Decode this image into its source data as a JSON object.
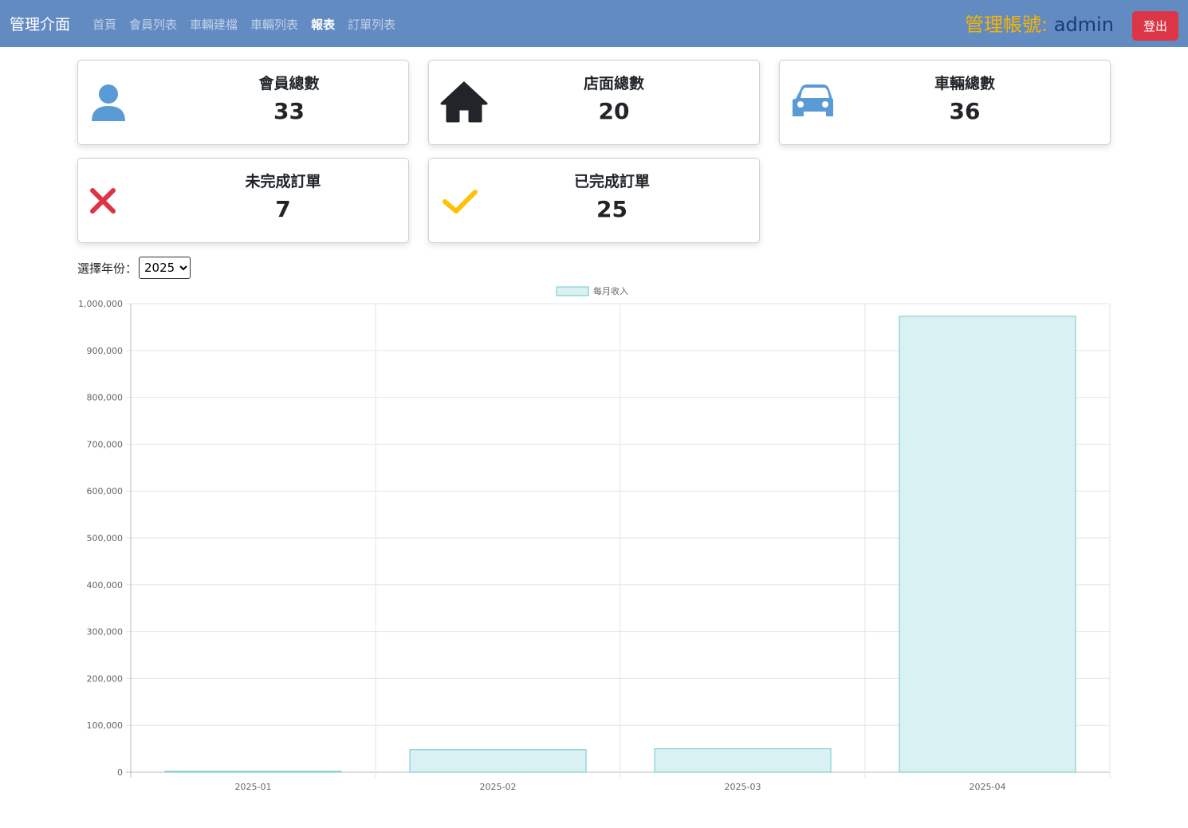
{
  "navbar": {
    "brand": "管理介面",
    "links": [
      {
        "label": "首頁",
        "active": false
      },
      {
        "label": "會員列表",
        "active": false
      },
      {
        "label": "車輛建檔",
        "active": false
      },
      {
        "label": "車輛列表",
        "active": false
      },
      {
        "label": "報表",
        "active": true
      },
      {
        "label": "訂單列表",
        "active": false
      }
    ],
    "admin_prefix": "管理帳號:",
    "admin_name": "admin",
    "logout_label": "登出"
  },
  "cards": [
    {
      "label": "會員總數",
      "value": "33",
      "icon": "user-icon",
      "icon_color": "#5b9bd5"
    },
    {
      "label": "店面總數",
      "value": "20",
      "icon": "house-icon",
      "icon_color": "#212529"
    },
    {
      "label": "車輛總數",
      "value": "36",
      "icon": "car-icon",
      "icon_color": "#5b9bd5"
    },
    {
      "label": "未完成訂單",
      "value": "7",
      "icon": "x-icon",
      "icon_color": "#dc3545"
    },
    {
      "label": "已完成訂單",
      "value": "25",
      "icon": "check-icon",
      "icon_color": "#ffc107"
    }
  ],
  "year_filter": {
    "label": "選擇年份：",
    "selected": "2025"
  },
  "chart_data": {
    "type": "bar",
    "categories": [
      "2025-01",
      "2025-02",
      "2025-03",
      "2025-04"
    ],
    "series": [
      {
        "name": "每月收入",
        "values": [
          2000,
          48000,
          50000,
          973000
        ]
      }
    ],
    "ylim": [
      0,
      1000000
    ],
    "yticks": [
      "0",
      "100,000",
      "200,000",
      "300,000",
      "400,000",
      "500,000",
      "600,000",
      "700,000",
      "800,000",
      "900,000",
      "1,000,000"
    ],
    "grid": true,
    "legend": "top-center",
    "bar_fill": "#d9f1f2",
    "bar_stroke": "#6fc7c7"
  }
}
